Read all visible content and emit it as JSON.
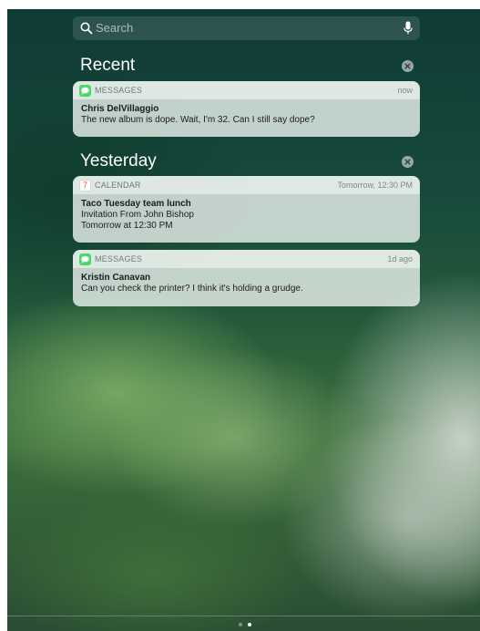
{
  "search": {
    "placeholder": "Search"
  },
  "sections": {
    "recent": {
      "title": "Recent"
    },
    "yesterday": {
      "title": "Yesterday"
    }
  },
  "notifications": [
    {
      "app": "MESSAGES",
      "time": "now",
      "sender": "Chris DelVillaggio",
      "lines": [
        "The new album is dope. Wait, I'm 32. Can I still say dope?"
      ],
      "icon": "messages-icon"
    },
    {
      "app": "CALENDAR",
      "time": "Tomorrow, 12:30 PM",
      "sender": "Taco Tuesday team lunch",
      "lines": [
        "Invitation From John Bishop",
        "Tomorrow at 12:30 PM"
      ],
      "icon": "calendar-icon",
      "calendar_day": "7"
    },
    {
      "app": "MESSAGES",
      "time": "1d ago",
      "sender": "Kristin Canavan",
      "lines": [
        "Can you check the printer? I think it's holding a grudge."
      ],
      "icon": "messages-icon"
    }
  ],
  "page_indicator": {
    "pages": 2,
    "current": 2
  },
  "colors": {
    "messages_green": "#4cd964",
    "calendar_red": "#ff3b30"
  }
}
